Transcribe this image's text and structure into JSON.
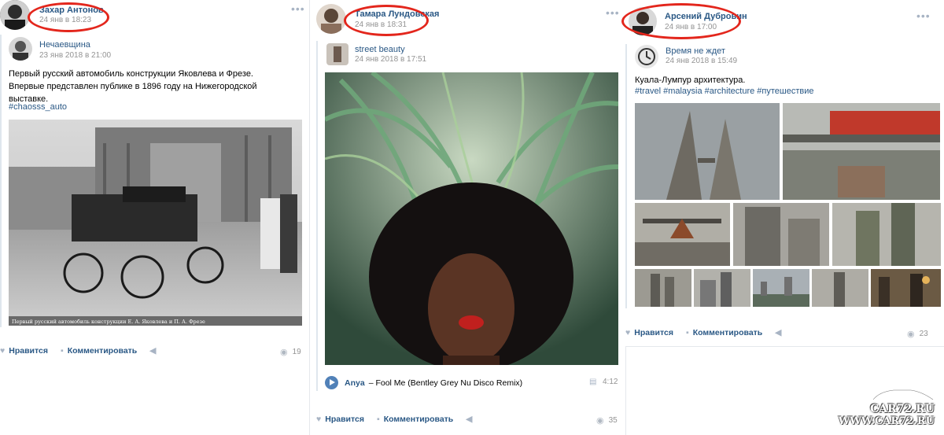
{
  "posts": [
    {
      "author": "Захар Антонов",
      "date": "24 янв в 18:23",
      "repost": {
        "source": "Нечаевщина",
        "date": "23 янв 2018 в 21:00"
      },
      "text": "Первый русский автомобиль конструкции Яковлева и Фрезе. Впервые представлен публике в 1896 году на Нижегородской выставке.",
      "hashtag": "#chaosss_auto",
      "photo_caption": "Первый русский автомобиль конструкции Е. А. Яковлева и П. А. Фрезе",
      "like_label": "Нравится",
      "comment_label": "Комментировать",
      "views": "19"
    },
    {
      "author": "Тамара Лундовская",
      "date": "24 янв в 18:31",
      "repost": {
        "source": "street beauty",
        "date": "24 янв 2018 в 17:51"
      },
      "audio": {
        "artist": "Anya",
        "title": "– Fool Me (Bentley Grey Nu Disco Remix)",
        "duration": "4:12"
      },
      "like_label": "Нравится",
      "comment_label": "Комментировать",
      "views": "35"
    },
    {
      "author": "Арсений Дубровин",
      "date": "24 янв в 17:00",
      "repost": {
        "source": "Время не ждет",
        "date": "24 янв 2018 в 15:49"
      },
      "text": "Куала-Лумпур архитектура.",
      "hashtags": "#travel #malaysia #architecture #путешествие",
      "like_label": "Нравится",
      "comment_label": "Комментировать",
      "views": "23"
    }
  ],
  "watermark": {
    "line1": "CAR72.RU",
    "line2": "WWW.CAR72.RU"
  },
  "colors": {
    "link": "#2a5885",
    "meta": "#939393",
    "highlight": "#e3261c"
  }
}
